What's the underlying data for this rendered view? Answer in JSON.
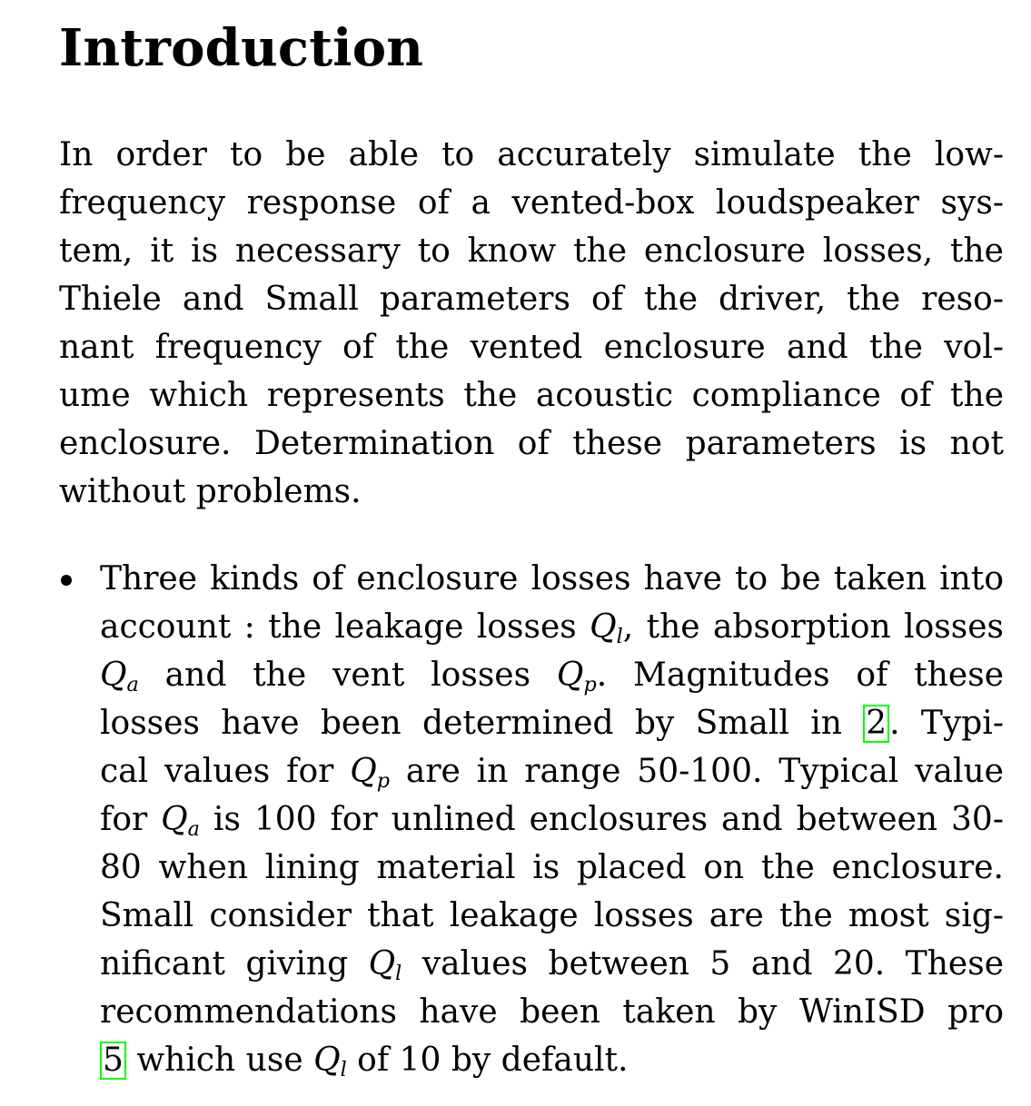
{
  "heading": "Introduction",
  "intro_lines": [
    "In order to be able to accurately simulate the low-",
    "frequency response of a vented-box loudspeaker sys-",
    "tem, it is necessary to know the enclosure losses, the",
    "Thiele and Small parameters of the driver, the reso-",
    "nant frequency of the vented enclosure and the vol-",
    "ume which represents the acoustic compliance of the",
    "enclosure.  Determination of these parameters is not",
    "without problems."
  ],
  "bullet": {
    "l1": "Three kinds of enclosure losses have to be taken into",
    "l2a": "account : the leakage losses ",
    "Q": "Q",
    "sub_l": "l",
    "sub_a": "a",
    "sub_p": "p",
    "l2b": ", the absorption losses",
    "l3a": " and the vent losses ",
    "l3b": ".  Magnitudes of these",
    "l4a": "losses have been determined by Small in ",
    "cite1": "2",
    "l4b": ".  Typi-",
    "l5a": "cal values for ",
    "l5b": " are in range 50-100.  Typical value",
    "l6a": "for ",
    "l6b": " is 100 for unlined enclosures and between 30-",
    "l7": "80 when lining material is placed on the enclosure.",
    "l8": "Small consider that leakage losses are the most sig-",
    "l9a": "nificant giving ",
    "l9b": " values between 5 and 20.  These",
    "l10": "recommendations have been taken by WinISD pro",
    "cite2": "5",
    "l11a": " which use ",
    "l11b": " of 10 by default."
  },
  "colors": {
    "citation_border": "#00ff00"
  }
}
